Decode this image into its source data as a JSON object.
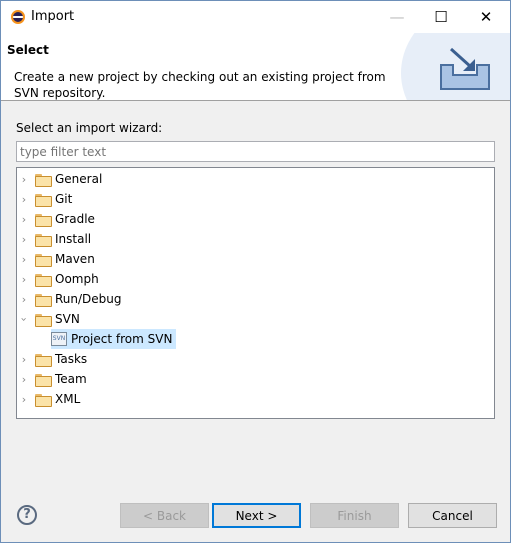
{
  "window": {
    "title": "Import",
    "minimize": "—",
    "maximize": "☐",
    "close": "✕"
  },
  "header": {
    "title": "Select",
    "description": "Create a new project by checking out an existing project from SVN repository."
  },
  "wizard_label": "Select an import wizard:",
  "filter": {
    "value": "",
    "placeholder": "type filter text"
  },
  "tree": [
    {
      "label": "General",
      "expanded": false
    },
    {
      "label": "Git",
      "expanded": false
    },
    {
      "label": "Gradle",
      "expanded": false
    },
    {
      "label": "Install",
      "expanded": false
    },
    {
      "label": "Maven",
      "expanded": false
    },
    {
      "label": "Oomph",
      "expanded": false
    },
    {
      "label": "Run/Debug",
      "expanded": false
    },
    {
      "label": "SVN",
      "expanded": true,
      "children": [
        {
          "label": "Project from SVN",
          "selected": true
        }
      ]
    },
    {
      "label": "Tasks",
      "expanded": false
    },
    {
      "label": "Team",
      "expanded": false
    },
    {
      "label": "XML",
      "expanded": false
    }
  ],
  "buttons": {
    "back": "< Back",
    "next": "Next >",
    "finish": "Finish",
    "cancel": "Cancel",
    "help": "?"
  }
}
